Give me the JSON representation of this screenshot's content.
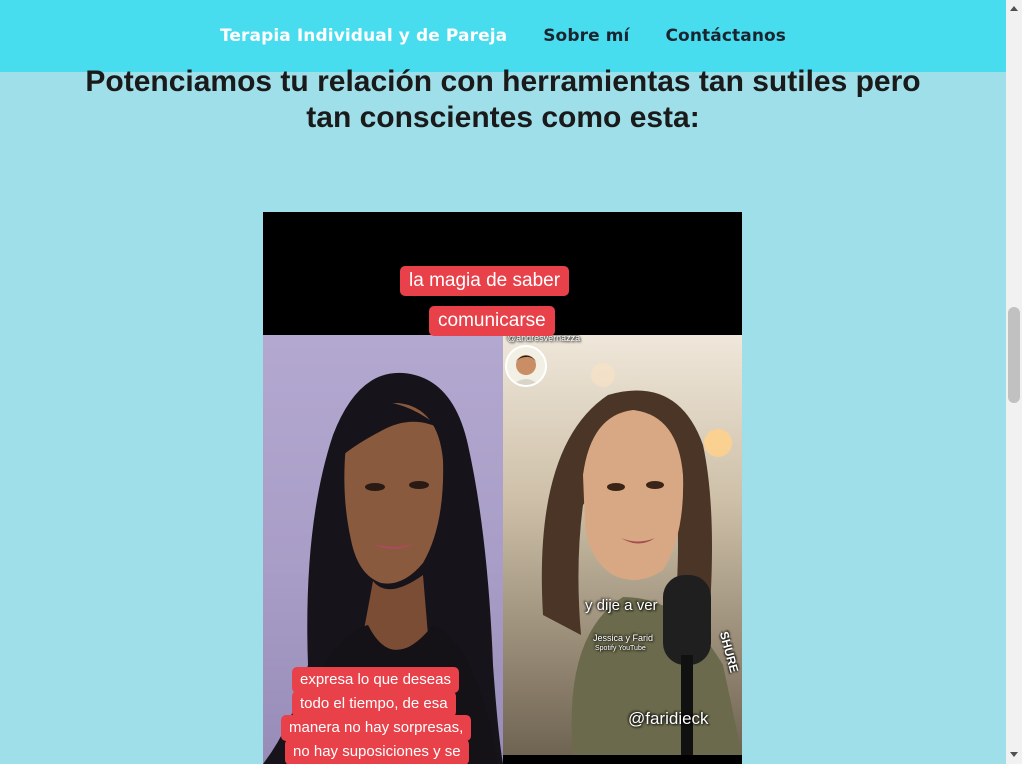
{
  "nav": {
    "items": [
      {
        "label": "Terapia Individual y de Pareja",
        "active": true
      },
      {
        "label": "Sobre mí",
        "active": false
      },
      {
        "label": "Contáctanos",
        "active": false
      }
    ]
  },
  "main": {
    "headline": "Potenciamos tu relación con herramientas tan sutiles pero tan conscientes como esta:"
  },
  "video": {
    "caption_top": [
      "la magia de saber",
      "comunicarse"
    ],
    "left_subtitles": [
      "expresa lo que deseas",
      "todo el tiempo, de esa",
      "manera no hay sorpresas,",
      "no hay suposiciones y se"
    ],
    "right_handle_top": "@andresvernazza",
    "right_subtitle": "y dije a ver",
    "right_show": "Jessica y Farid",
    "right_platforms": "Spotify  YouTube",
    "right_handle_bottom": "@faridieck",
    "mic_brand": "SHURE"
  },
  "colors": {
    "nav_bg": "#48dcef",
    "page_bg": "#9fdfe9",
    "caption_red": "#e8414a",
    "nav_active": "#ffffff",
    "nav_text": "#1b2530"
  }
}
